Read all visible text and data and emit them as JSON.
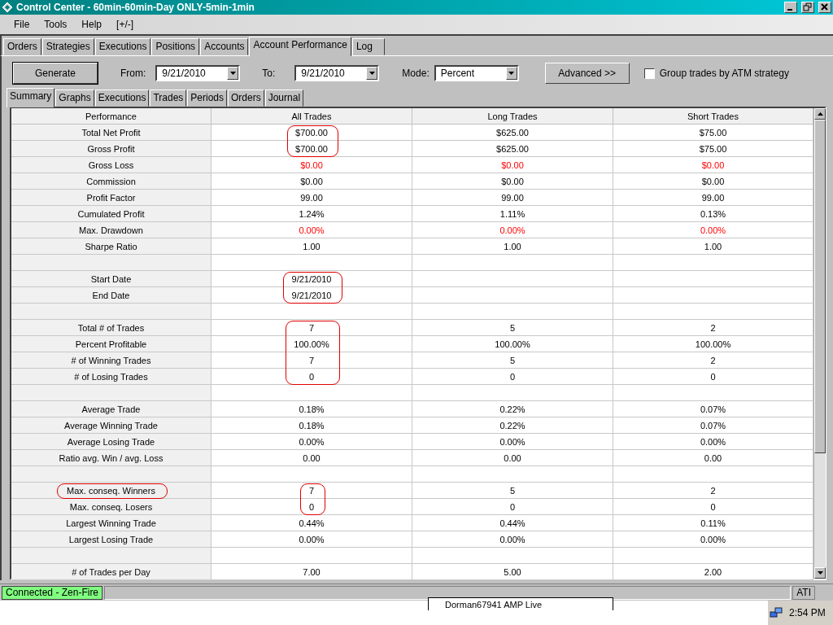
{
  "window": {
    "title": "Control Center - 60min-60min-Day ONLY-5min-1min"
  },
  "menu": [
    "File",
    "Tools",
    "Help",
    "[+/-]"
  ],
  "tabs": [
    {
      "label": "Orders",
      "selected": false
    },
    {
      "label": "Strategies",
      "selected": false
    },
    {
      "label": "Executions",
      "selected": false
    },
    {
      "label": "Positions",
      "selected": false
    },
    {
      "label": "Accounts",
      "selected": false
    },
    {
      "label": "Account Performance",
      "selected": true
    },
    {
      "label": "Log",
      "selected": false
    }
  ],
  "toolbar": {
    "generate": "Generate",
    "from_label": "From:",
    "from": "9/21/2010",
    "to_label": "To:",
    "to": "9/21/2010",
    "mode_label": "Mode:",
    "mode": "Percent",
    "advanced": "Advanced >>",
    "group_trades": {
      "label": "Group trades by ATM strategy",
      "checked": false
    }
  },
  "subtabs": [
    {
      "label": "Summary",
      "selected": true
    },
    {
      "label": "Graphs",
      "selected": false
    },
    {
      "label": "Executions",
      "selected": false
    },
    {
      "label": "Trades",
      "selected": false
    },
    {
      "label": "Periods",
      "selected": false
    },
    {
      "label": "Orders",
      "selected": false
    },
    {
      "label": "Journal",
      "selected": false
    }
  ],
  "table": {
    "columns": [
      "Performance",
      "All Trades",
      "Long Trades",
      "Short Trades"
    ],
    "rows": [
      {
        "kind": "normal",
        "label": "Total Net Profit",
        "values": [
          "$700.00",
          "$625.00",
          "$75.00"
        ],
        "circled": [
          false,
          true,
          false,
          false
        ]
      },
      {
        "kind": "normal",
        "label": "Gross Profit",
        "values": [
          "$700.00",
          "$625.00",
          "$75.00"
        ],
        "circled": [
          false,
          true,
          false,
          false
        ]
      },
      {
        "kind": "loss",
        "label": "Gross Loss",
        "values": [
          "$0.00",
          "$0.00",
          "$0.00"
        ]
      },
      {
        "kind": "normal",
        "label": "Commission",
        "values": [
          "$0.00",
          "$0.00",
          "$0.00"
        ]
      },
      {
        "kind": "normal",
        "label": "Profit Factor",
        "values": [
          "99.00",
          "99.00",
          "99.00"
        ]
      },
      {
        "kind": "normal",
        "label": "Cumulated Profit",
        "values": [
          "1.24%",
          "1.11%",
          "0.13%"
        ]
      },
      {
        "kind": "loss",
        "label": "Max. Drawdown",
        "values": [
          "0.00%",
          "0.00%",
          "0.00%"
        ]
      },
      {
        "kind": "normal",
        "label": "Sharpe Ratio",
        "values": [
          "1.00",
          "1.00",
          "1.00"
        ]
      },
      {
        "kind": "blank"
      },
      {
        "kind": "normal",
        "label": "Start Date",
        "values": [
          "9/21/2010"
        ],
        "circled": [
          false,
          true
        ]
      },
      {
        "kind": "normal",
        "label": "End Date",
        "values": [
          "9/21/2010"
        ],
        "circled": [
          false,
          true
        ]
      },
      {
        "kind": "blank"
      },
      {
        "kind": "normal",
        "label": "Total # of Trades",
        "values": [
          "7",
          "5",
          "2"
        ],
        "circled": [
          false,
          true,
          false,
          false
        ]
      },
      {
        "kind": "normal",
        "label": "Percent Profitable",
        "values": [
          "100.00%",
          "100.00%",
          "100.00%"
        ],
        "circled": [
          false,
          true,
          false,
          false
        ]
      },
      {
        "kind": "normal",
        "label": "# of Winning Trades",
        "values": [
          "7",
          "5",
          "2"
        ],
        "circled": [
          false,
          true,
          false,
          false
        ]
      },
      {
        "kind": "normal",
        "label": "# of Losing Trades",
        "values": [
          "0",
          "0",
          "0"
        ],
        "circled": [
          false,
          true,
          false,
          false
        ]
      },
      {
        "kind": "blank"
      },
      {
        "kind": "normal",
        "label": "Average Trade",
        "values": [
          "0.18%",
          "0.22%",
          "0.07%"
        ]
      },
      {
        "kind": "normal",
        "label": "Average Winning Trade",
        "values": [
          "0.18%",
          "0.22%",
          "0.07%"
        ]
      },
      {
        "kind": "normal",
        "label": "Average Losing Trade",
        "values": [
          "0.00%",
          "0.00%",
          "0.00%"
        ]
      },
      {
        "kind": "normal",
        "label": "Ratio avg. Win / avg. Loss",
        "values": [
          "0.00",
          "0.00",
          "0.00"
        ]
      },
      {
        "kind": "blank"
      },
      {
        "kind": "normal",
        "label": "Max. conseq. Winners",
        "values": [
          "7",
          "5",
          "2"
        ],
        "circled": [
          true,
          true,
          false,
          false
        ]
      },
      {
        "kind": "normal",
        "label": "Max. conseq. Losers",
        "values": [
          "0",
          "0",
          "0"
        ],
        "circled": [
          false,
          true,
          false,
          false
        ]
      },
      {
        "kind": "normal",
        "label": "Largest Winning Trade",
        "values": [
          "0.44%",
          "0.44%",
          "0.11%"
        ]
      },
      {
        "kind": "normal",
        "label": "Largest Losing Trade",
        "values": [
          "0.00%",
          "0.00%",
          "0.00%"
        ]
      },
      {
        "kind": "blank"
      },
      {
        "kind": "normal",
        "label": "# of Trades per Day",
        "values": [
          "7.00",
          "5.00",
          "2.00"
        ]
      }
    ]
  },
  "status_bar": {
    "connection": "Connected - Zen-Fire",
    "connected": true,
    "right": "ATI"
  },
  "taskbar": {
    "window_button": "Dorman67941 AMP Live",
    "time": "2:54 PM"
  }
}
